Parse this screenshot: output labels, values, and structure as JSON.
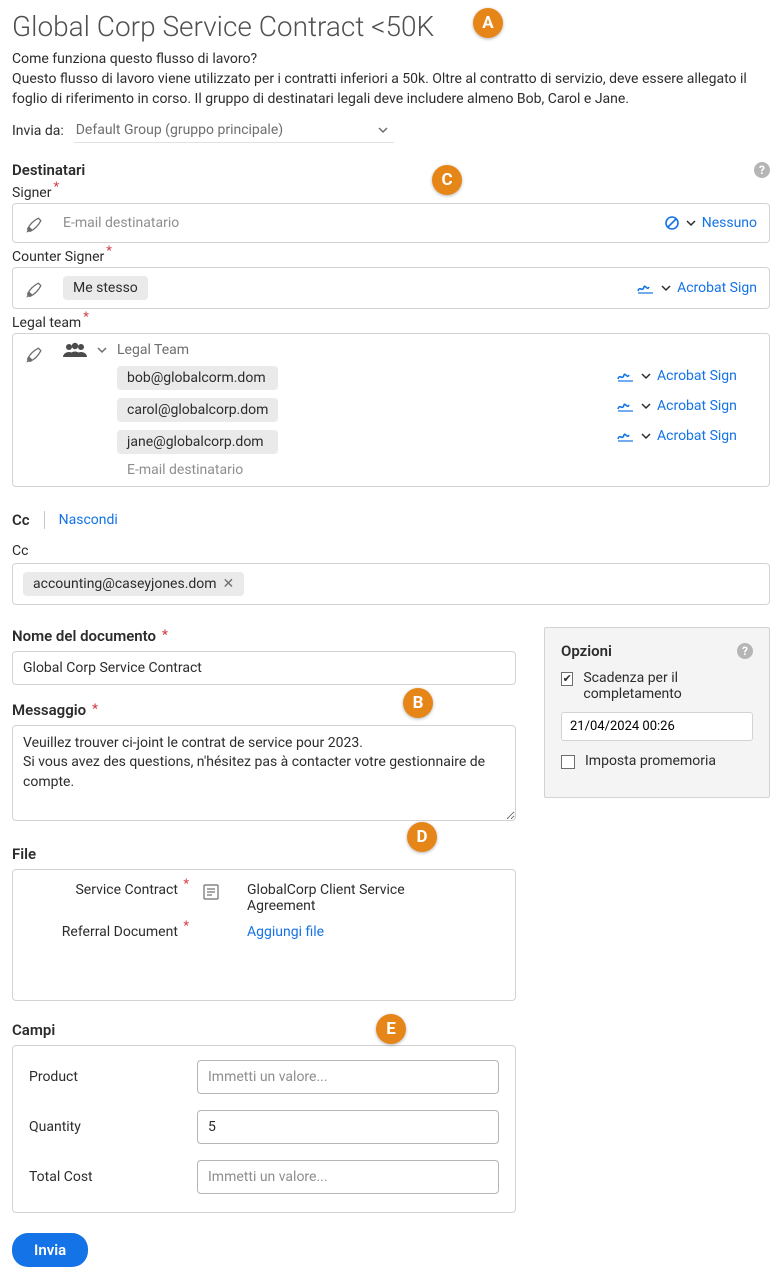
{
  "title": "Global Corp Service Contract <50K",
  "intro_question": "Come funziona questo flusso di lavoro?",
  "intro_body": "Questo flusso di lavoro viene utilizzato per i contratti inferiori a 50k. Oltre al contratto di servizio, deve essere allegato il foglio di riferimento in corso. Il gruppo di destinatari legali deve includere almeno Bob, Carol e Jane.",
  "send_from_label": "Invia da:",
  "send_from_value": "Default Group (gruppo principale)",
  "recipients": {
    "section_label": "Destinatari",
    "signer": {
      "label": "Signer",
      "placeholder": "E-mail destinatario",
      "auth": "Nessuno"
    },
    "counter": {
      "label": "Counter Signer",
      "chip": "Me stesso",
      "auth": "Acrobat Sign"
    },
    "legal": {
      "label": "Legal team",
      "group_name": "Legal Team",
      "emails": [
        "bob@globalcorm.dom",
        "carol@globalcorp.dom",
        "jane@globalcorp.dom"
      ],
      "placeholder": "E-mail destinatario",
      "auth": "Acrobat Sign"
    }
  },
  "cc": {
    "cc_label": "Cc",
    "hide": "Nascondi",
    "sub_label": "Cc",
    "chip": "accounting@caseyjones.dom"
  },
  "doc_name": {
    "label": "Nome del documento",
    "value": "Global Corp Service Contract"
  },
  "message": {
    "label": "Messaggio",
    "value": "Veuillez trouver ci-joint le contrat de service pour 2023.\nSi vous avez des questions, n'hésitez pas à contacter votre gestionnaire de compte."
  },
  "options": {
    "title": "Opzioni",
    "deadline_label": "Scadenza per il completamento",
    "deadline_value": "21/04/2024 00:26",
    "reminder_label": "Imposta promemoria"
  },
  "files": {
    "label": "File",
    "rows": [
      {
        "name": "Service Contract",
        "file": "GlobalCorp Client Service Agreement"
      },
      {
        "name": "Referral Document",
        "file_link": "Aggiungi file"
      }
    ]
  },
  "campi": {
    "label": "Campi",
    "rows": [
      {
        "label": "Product",
        "placeholder": "Immetti un valore...",
        "value": ""
      },
      {
        "label": "Quantity",
        "placeholder": "",
        "value": "5"
      },
      {
        "label": "Total Cost",
        "placeholder": "Immetti un valore...",
        "value": ""
      }
    ]
  },
  "submit": "Invia",
  "markers": {
    "A": "A",
    "B": "B",
    "C": "C",
    "D": "D",
    "E": "E"
  }
}
